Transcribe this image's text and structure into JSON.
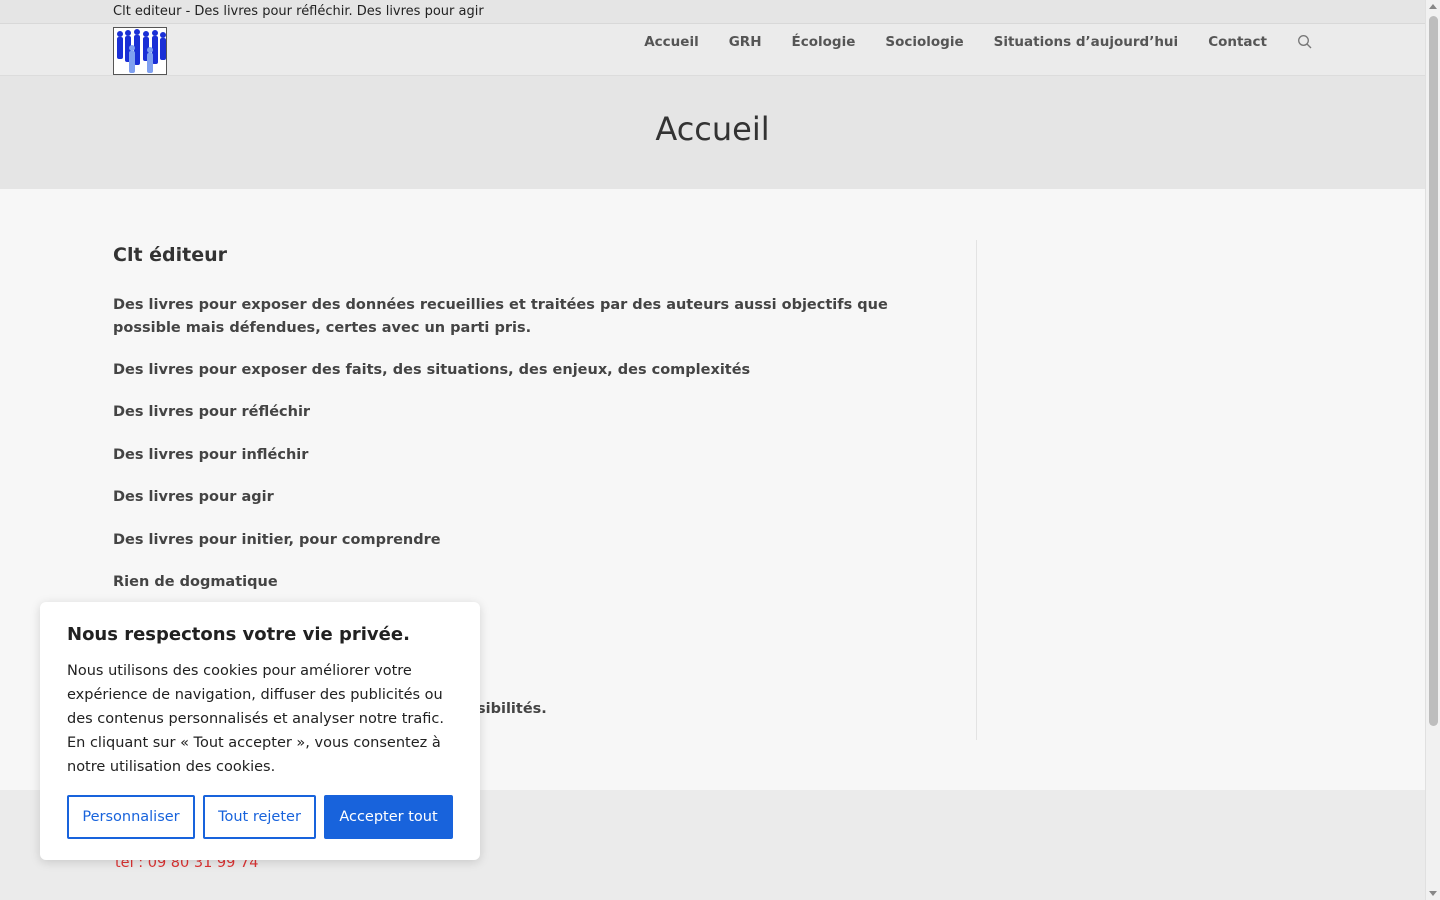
{
  "topbar": {
    "tagline": "Clt editeur - Des livres pour réfléchir. Des livres pour agir"
  },
  "header": {
    "logo_label": "logo",
    "nav": [
      {
        "label": "Accueil"
      },
      {
        "label": "GRH"
      },
      {
        "label": "Écologie"
      },
      {
        "label": "Sociologie"
      },
      {
        "label": "Situations d’aujourd’hui"
      },
      {
        "label": "Contact"
      }
    ],
    "search_icon": "search-icon"
  },
  "hero": {
    "title": "Accueil"
  },
  "main": {
    "heading": "Clt éditeur",
    "paragraphs": [
      "Des livres pour exposer des données recueillies et traitées par des auteurs aussi objectifs que possible mais défendues, certes avec un parti pris.",
      "Des livres pour exposer des faits, des situations, des enjeux, des complexités",
      "Des livres pour réfléchir",
      "Des livres pour infléchir",
      "Des livres pour agir",
      "Des livres pour initier, pour comprendre",
      "Rien de dogmatique",
      "sibilités."
    ]
  },
  "footer": {
    "phone": "tel : 09 80 31 99 74"
  },
  "cookie_banner": {
    "title": "Nous respectons votre vie privée.",
    "text": "Nous utilisons des cookies pour améliorer votre expérience de navigation, diffuser des publicités ou des contenus personnalisés et analyser notre trafic. En cliquant sur « Tout accepter », vous consentez à notre utilisation des cookies.",
    "buttons": {
      "customize": "Personnaliser",
      "reject": "Tout rejeter",
      "accept": "Accepter tout"
    }
  },
  "colors": {
    "accent": "#1863dc",
    "phone": "#dd3333"
  }
}
